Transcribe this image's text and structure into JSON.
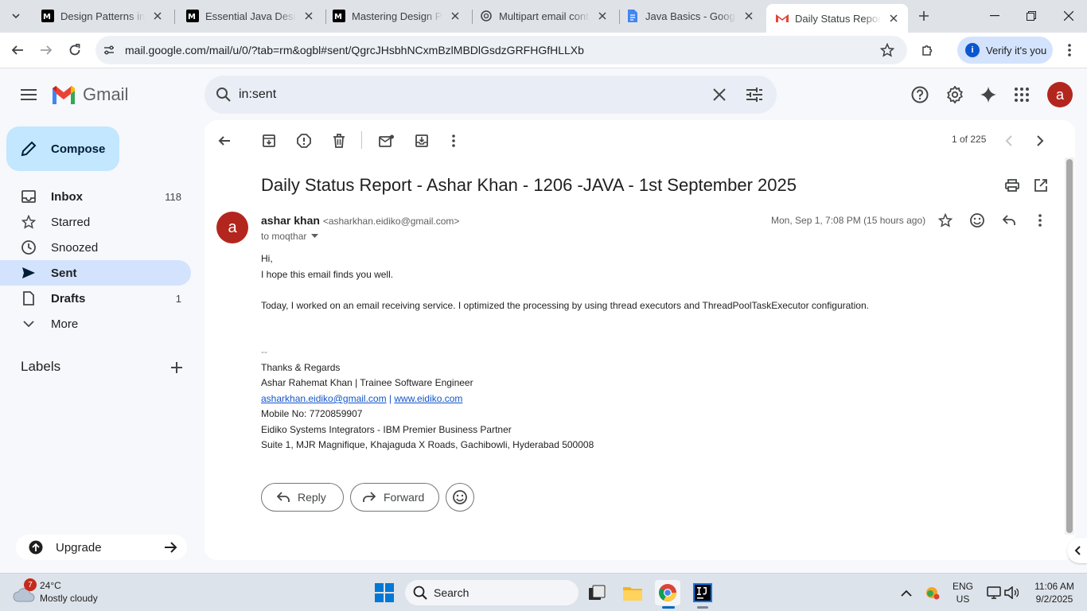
{
  "browser": {
    "tabs": [
      {
        "title": "Design Patterns in Java",
        "icon": "medium-icon"
      },
      {
        "title": "Essential Java Design",
        "icon": "medium-icon"
      },
      {
        "title": "Mastering Design Pat",
        "icon": "medium-icon"
      },
      {
        "title": "Multipart email conte",
        "icon": "openai-icon"
      },
      {
        "title": "Java Basics - Google",
        "icon": "docs-icon"
      },
      {
        "title": "Daily Status Report -",
        "icon": "gmail-icon",
        "active": true
      }
    ],
    "url": "mail.google.com/mail/u/0/?tab=rm&ogbl#sent/QgrcJHsbhNCxmBzlMBDlGsdzGRFHGfHLLXb",
    "verify_label": "Verify it's you"
  },
  "gmail": {
    "logo_text": "Gmail",
    "search_value": "in:sent",
    "avatar_letter": "a",
    "compose_label": "Compose",
    "nav": [
      {
        "label": "Inbox",
        "count": "118",
        "icon": "inbox-icon"
      },
      {
        "label": "Starred",
        "count": "",
        "icon": "star-icon"
      },
      {
        "label": "Snoozed",
        "count": "",
        "icon": "clock-icon"
      },
      {
        "label": "Sent",
        "count": "",
        "icon": "send-icon",
        "active": true
      },
      {
        "label": "Drafts",
        "count": "1",
        "icon": "draft-icon"
      },
      {
        "label": "More",
        "count": "",
        "icon": "chevron-down-icon"
      }
    ],
    "labels_header": "Labels",
    "upgrade_label": "Upgrade"
  },
  "message": {
    "pager": "1 of 225",
    "subject": "Daily Status Report - Ashar Khan - 1206 -JAVA - 1st September 2025",
    "sender_name": "ashar khan",
    "sender_email": "<asharkhan.eidiko@gmail.com>",
    "to": "to moqthar",
    "date": "Mon, Sep 1, 7:08 PM (15 hours ago)",
    "avatar_letter": "a",
    "body": {
      "greeting": "Hi,",
      "line1": "I hope this email finds you well.",
      "line2": "Today, I worked on an email receiving service. I optimized the processing by using thread executors and ThreadPoolTaskExecutor configuration.",
      "sig_dash": "--",
      "sig1": "Thanks & Regards",
      "sig2": "Ashar Rahemat Khan | Trainee Software Engineer",
      "sig_email": "asharkhan.eidiko@gmail.com",
      "sig_sep": " | ",
      "sig_site": "www.eidiko.com",
      "sig3": "Mobile No: 7720859907",
      "sig4": "Eidiko Systems Integrators - IBM Premier Business Partner",
      "sig5": "Suite 1, MJR Magnifique, Khajaguda X Roads, Gachibowli, Hyderabad 500008"
    },
    "reply_label": "Reply",
    "forward_label": "Forward"
  },
  "taskbar": {
    "weather_badge": "7",
    "temp": "24°C",
    "condition": "Mostly cloudy",
    "search_label": "Search",
    "lang1": "ENG",
    "lang2": "US",
    "time": "11:06 AM",
    "date": "9/2/2025"
  },
  "colors": {
    "gmail_red": "#ea4335",
    "avatar": "#b3261e",
    "compose_bg": "#c2e7ff",
    "active_nav": "#d3e3fd"
  }
}
